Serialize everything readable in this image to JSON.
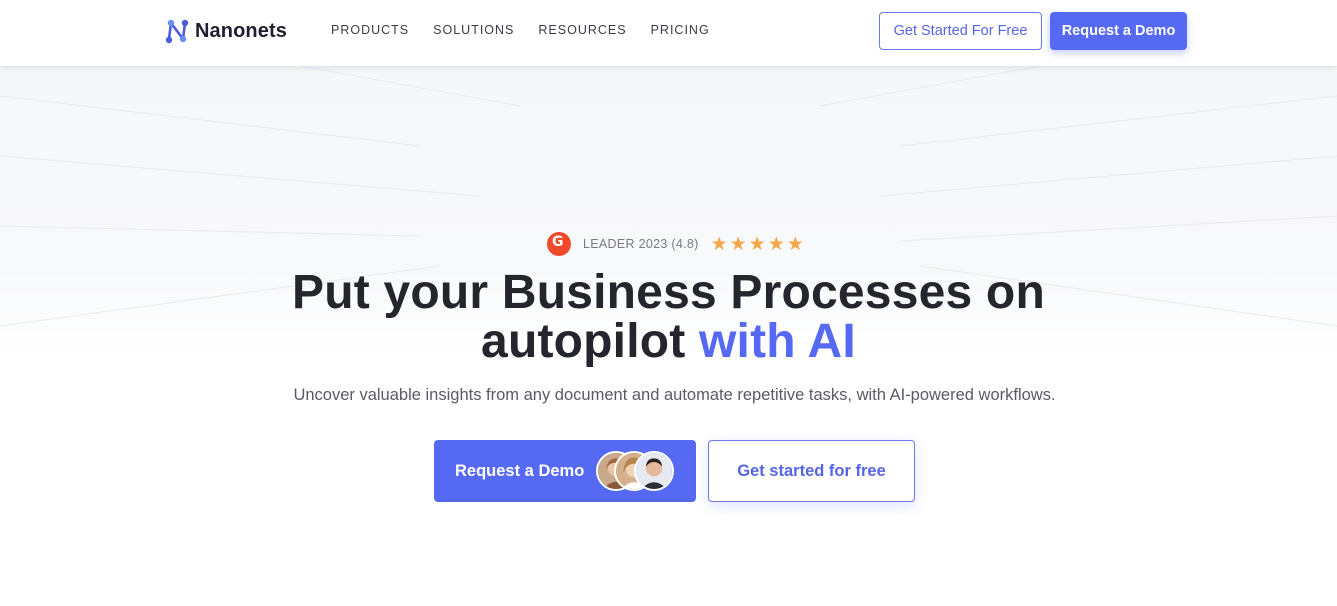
{
  "header": {
    "logo_text": "Nanonets",
    "nav": [
      "PRODUCTS",
      "SOLUTIONS",
      "RESOURCES",
      "PRICING"
    ],
    "get_started_label": "Get Started For Free",
    "demo_label": "Request a Demo"
  },
  "hero": {
    "badge_text": "LEADER 2023 (4.8)",
    "rating_stars": 5,
    "headline_line1": "Put your Business Processes on",
    "headline_line2_plain": "autopilot ",
    "headline_line2_accent": "with AI",
    "subtext": "Uncover valuable insights from any document and automate repetitive tasks, with AI-powered workflows.",
    "cta_primary": "Request a Demo",
    "cta_secondary": "Get started for free"
  },
  "colors": {
    "brand": "#5669f2",
    "star": "#f5a74a",
    "g2": "#ef4a2c"
  }
}
